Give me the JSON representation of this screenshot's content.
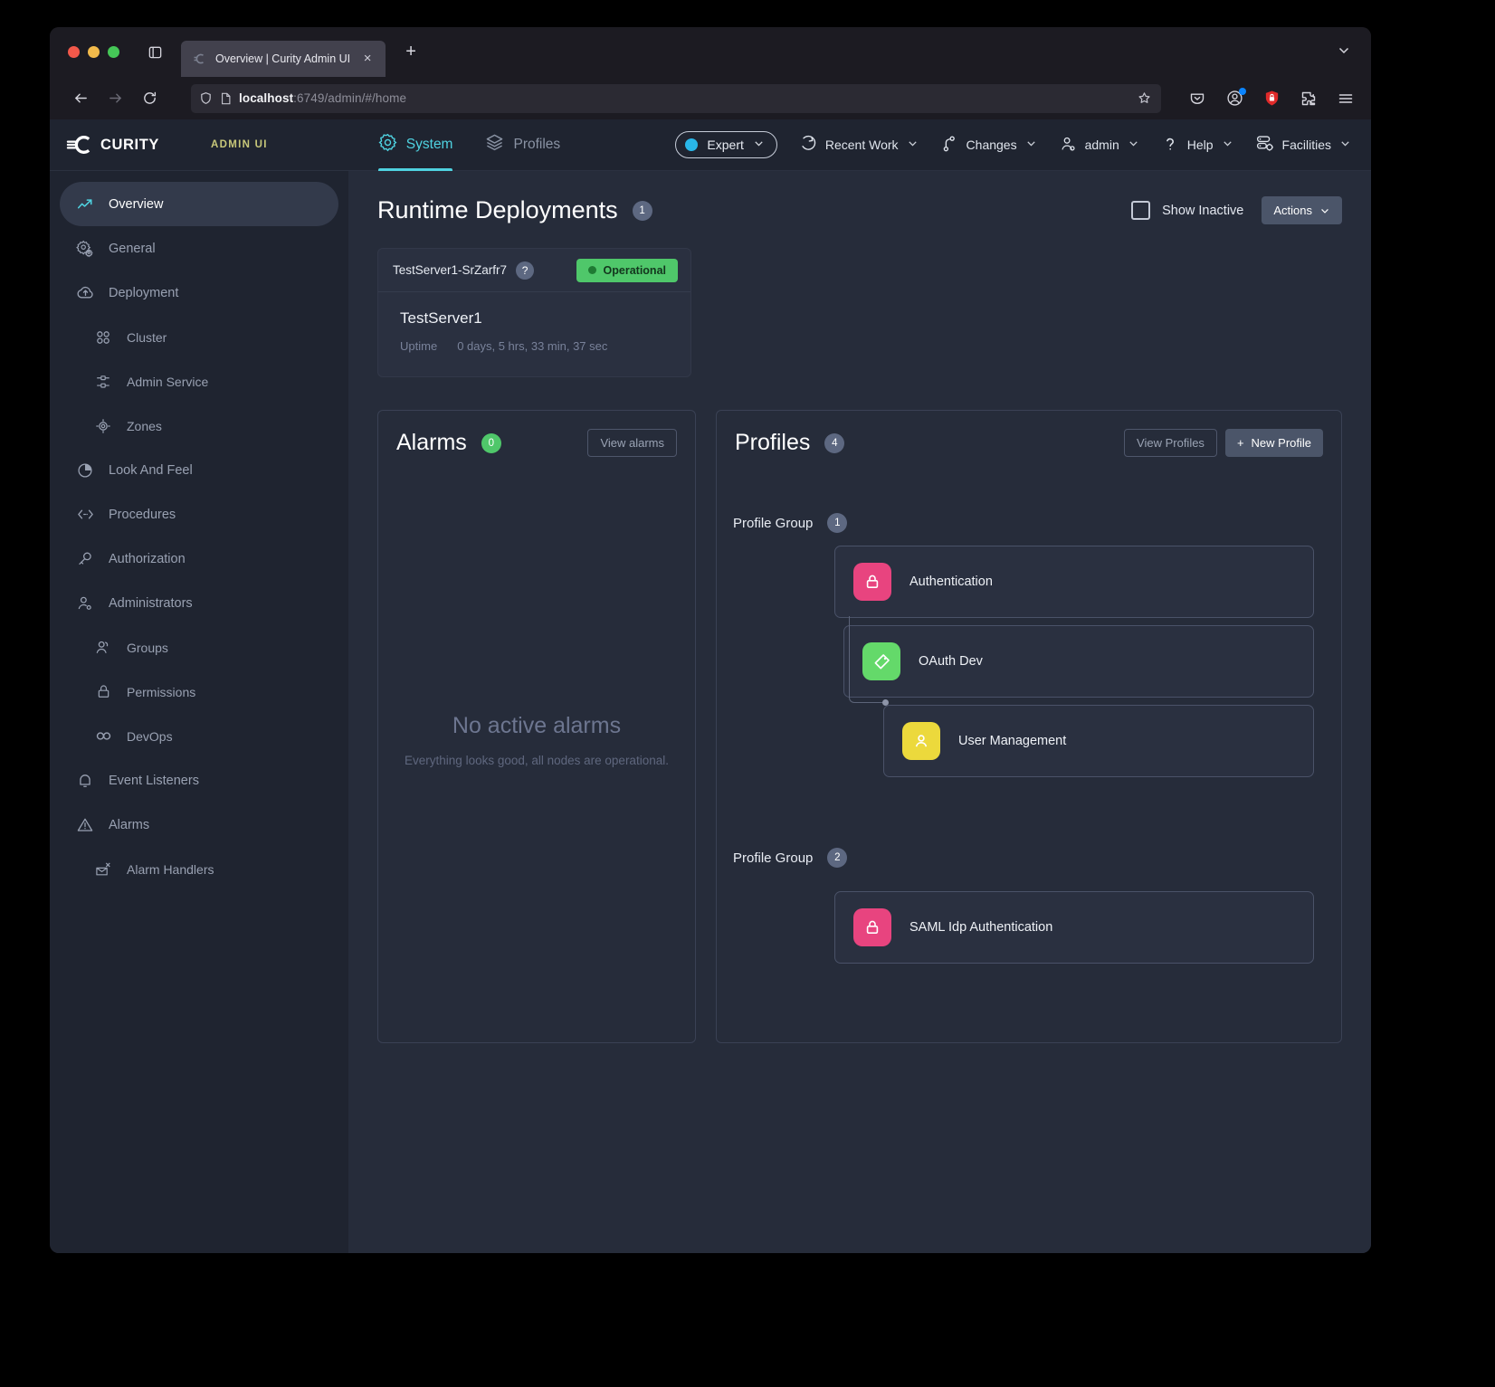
{
  "browser": {
    "tab_title": "Overview | Curity Admin UI",
    "url_host": "localhost",
    "url_rest": ":6749/admin/#/home",
    "new_tab_label": "+",
    "close_label": "×"
  },
  "appheader": {
    "brand": "CURITY",
    "subtitle": "ADMIN UI",
    "tabs": [
      {
        "label": "System",
        "icon": "gear-icon",
        "active": true
      },
      {
        "label": "Profiles",
        "icon": "layers-icon",
        "active": false
      }
    ],
    "mode_pill": "Expert",
    "items": [
      {
        "label": "Recent Work",
        "icon": "history-icon"
      },
      {
        "label": "Changes",
        "icon": "branch-icon"
      },
      {
        "label": "admin",
        "icon": "user-icon"
      },
      {
        "label": "Help",
        "icon": "question-icon"
      },
      {
        "label": "Facilities",
        "icon": "server-settings-icon"
      }
    ]
  },
  "sidebar": {
    "items": [
      {
        "label": "Overview",
        "icon": "trend-up-icon",
        "active": true,
        "sub": false
      },
      {
        "label": "General",
        "icon": "gears-icon",
        "active": false,
        "sub": false
      },
      {
        "label": "Deployment",
        "icon": "cloud-upload-icon",
        "active": false,
        "sub": false
      },
      {
        "label": "Cluster",
        "icon": "four-circles-icon",
        "active": false,
        "sub": true
      },
      {
        "label": "Admin Service",
        "icon": "nodes-icon",
        "active": false,
        "sub": true
      },
      {
        "label": "Zones",
        "icon": "target-icon",
        "active": false,
        "sub": true
      },
      {
        "label": "Look And Feel",
        "icon": "palette-icon",
        "active": false,
        "sub": false
      },
      {
        "label": "Procedures",
        "icon": "code-icon",
        "active": false,
        "sub": false
      },
      {
        "label": "Authorization",
        "icon": "key-icon",
        "active": false,
        "sub": false
      },
      {
        "label": "Administrators",
        "icon": "user-gear-icon",
        "active": false,
        "sub": false
      },
      {
        "label": "Groups",
        "icon": "users-icon",
        "active": false,
        "sub": true
      },
      {
        "label": "Permissions",
        "icon": "lock-icon",
        "active": false,
        "sub": true
      },
      {
        "label": "DevOps",
        "icon": "infinity-icon",
        "active": false,
        "sub": true
      },
      {
        "label": "Event Listeners",
        "icon": "bell-icon",
        "active": false,
        "sub": false
      },
      {
        "label": "Alarms",
        "icon": "warning-triangle-icon",
        "active": false,
        "sub": false
      },
      {
        "label": "Alarm Handlers",
        "icon": "alarm-handler-icon",
        "active": false,
        "sub": true
      }
    ]
  },
  "page": {
    "title": "Runtime Deployments",
    "count": "1",
    "show_inactive_label": "Show Inactive",
    "actions_label": "Actions"
  },
  "deployment": {
    "name": "TestServer1-SrZarfr7",
    "help_glyph": "?",
    "status": "Operational",
    "server_name": "TestServer1",
    "uptime_label": "Uptime",
    "uptime_value": "0 days, 5 hrs, 33 min, 37 sec"
  },
  "alarms": {
    "title": "Alarms",
    "count": "0",
    "view_label": "View alarms",
    "empty_title": "No active alarms",
    "empty_sub": "Everything looks good, all nodes are operational."
  },
  "profiles": {
    "title": "Profiles",
    "count": "4",
    "view_label": "View Profiles",
    "new_label": "New Profile",
    "plus_glyph": "+",
    "groups": [
      {
        "label": "Profile Group",
        "count": "1",
        "items": [
          {
            "name": "Authentication",
            "icon": "lock-icon",
            "color": "pink",
            "level": 1
          },
          {
            "name": "OAuth Dev",
            "icon": "token-icon",
            "color": "green",
            "level": 2
          },
          {
            "name": "User Management",
            "icon": "user-icon",
            "color": "yellow",
            "level": 3
          }
        ]
      },
      {
        "label": "Profile Group",
        "count": "2",
        "items": [
          {
            "name": "SAML Idp Authentication",
            "icon": "lock-icon",
            "color": "pink",
            "level": 1
          }
        ]
      }
    ]
  },
  "colors": {
    "accent": "#4fd2e0",
    "brand_yellow": "#c8c87a",
    "status_green": "#4fc76a",
    "tile_pink": "#e8447f",
    "tile_green": "#64d96a",
    "tile_yellow": "#ecd93c"
  }
}
